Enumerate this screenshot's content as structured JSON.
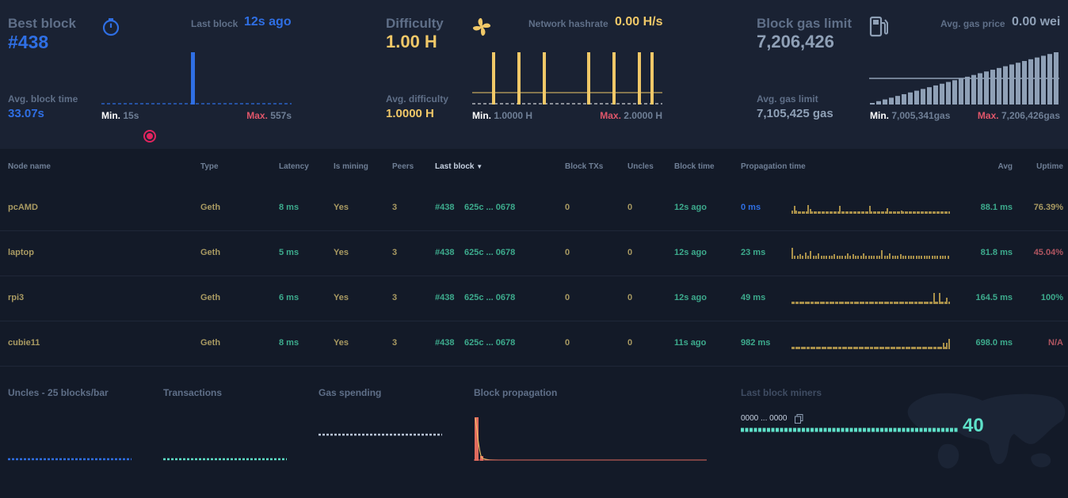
{
  "stats": {
    "best_block": {
      "label": "Best block",
      "value": "#438"
    },
    "avg_block_time": {
      "label": "Avg. block time",
      "value": "33.07s"
    },
    "last_block": {
      "label": "Last block",
      "value": "12s ago"
    },
    "block_time_chart": {
      "min_label": "Min.",
      "min_value": "15s",
      "max_label": "Max.",
      "max_value": "557s"
    },
    "difficulty": {
      "label": "Difficulty",
      "value": "1.00 H"
    },
    "avg_difficulty": {
      "label": "Avg. difficulty",
      "value": "1.0000 H"
    },
    "network_hashrate": {
      "label": "Network hashrate",
      "value": "0.00 H/s"
    },
    "difficulty_chart": {
      "min_label": "Min.",
      "min_value": "1.0000 H",
      "max_label": "Max.",
      "max_value": "2.0000 H"
    },
    "block_gas_limit": {
      "label": "Block gas limit",
      "value": "7,206,426"
    },
    "avg_gas_limit": {
      "label": "Avg. gas limit",
      "value": "7,105,425 gas"
    },
    "avg_gas_price": {
      "label": "Avg. gas price",
      "value": "0.00 wei"
    },
    "gas_chart": {
      "min_label": "Min.",
      "min_value": "7,005,341gas",
      "max_label": "Max.",
      "max_value": "7,206,426gas"
    }
  },
  "table": {
    "headers": [
      "Node name",
      "Type",
      "Latency",
      "Is mining",
      "Peers",
      "Last block",
      "Block TXs",
      "Uncles",
      "Block time",
      "Propagation time",
      "Avg",
      "Uptime"
    ],
    "sort_indicator": "▼",
    "rows": [
      {
        "name": "pcAMD",
        "type": "Geth",
        "latency": "8 ms",
        "mining": "Yes",
        "peers": "3",
        "block": "#438",
        "hash": "625c ... 0678",
        "txs": "0",
        "uncles": "0",
        "block_time": "12s ago",
        "prop": "0 ms",
        "avg": "88.1 ms",
        "uptime": "76.39%",
        "uptime_color": "#a99a62",
        "prop_color": "#2f6fe4"
      },
      {
        "name": "laptop",
        "type": "Geth",
        "latency": "5 ms",
        "mining": "Yes",
        "peers": "3",
        "block": "#438",
        "hash": "625c ... 0678",
        "txs": "0",
        "uncles": "0",
        "block_time": "12s ago",
        "prop": "23 ms",
        "avg": "81.8 ms",
        "uptime": "45.04%",
        "uptime_color": "#b05560",
        "prop_color": "#3dab8d"
      },
      {
        "name": "rpi3",
        "type": "Geth",
        "latency": "6 ms",
        "mining": "Yes",
        "peers": "3",
        "block": "#438",
        "hash": "625c ... 0678",
        "txs": "0",
        "uncles": "0",
        "block_time": "12s ago",
        "prop": "49 ms",
        "avg": "164.5 ms",
        "uptime": "100%",
        "uptime_color": "#3dab8d",
        "prop_color": "#3dab8d"
      },
      {
        "name": "cubie11",
        "type": "Geth",
        "latency": "8 ms",
        "mining": "Yes",
        "peers": "3",
        "block": "#438",
        "hash": "625c ... 0678",
        "txs": "0",
        "uncles": "0",
        "block_time": "11s ago",
        "prop": "982 ms",
        "avg": "698.0 ms",
        "uptime": "N/A",
        "uptime_color": "#b05560",
        "prop_color": "#3dab8d"
      }
    ],
    "prop_histograms": [
      [
        0.3,
        0.7,
        0.3,
        0.2,
        0.2,
        0.2,
        0.2,
        0.2,
        0.8,
        0.4,
        0.2,
        0.2,
        0.2,
        0.2,
        0.2,
        0.2,
        0.2,
        0.2,
        0.2,
        0.2,
        0.2,
        0.2,
        0.2,
        0.2,
        0.7,
        0.2,
        0.2,
        0.2,
        0.2,
        0.2,
        0.2,
        0.2,
        0.2,
        0.2,
        0.2,
        0.2,
        0.2,
        0.2,
        0.2,
        0.7,
        0.2,
        0.2,
        0.2,
        0.2,
        0.2,
        0.2,
        0.2,
        0.2,
        0.5,
        0.2,
        0.2,
        0.2,
        0.2,
        0.2,
        0.2,
        0.3,
        0.2,
        0.2,
        0.2,
        0.2,
        0.2,
        0.2,
        0.2,
        0.2,
        0.2,
        0.2,
        0.2,
        0.2,
        0.2,
        0.2,
        0.2,
        0.2,
        0.2,
        0.2,
        0.2,
        0.2,
        0.2,
        0.2,
        0.2,
        0.2
      ],
      [
        1,
        0.3,
        0.3,
        0.4,
        0.3,
        0.6,
        0.3,
        0.7,
        0.3,
        0.3,
        0.5,
        0.3,
        0.3,
        0.3,
        0.3,
        0.3,
        0.4,
        0.3,
        0.3,
        0.3,
        0.3,
        0.5,
        0.3,
        0.4,
        0.3,
        0.3,
        0.3,
        0.5,
        0.3,
        0.3,
        0.3,
        0.3,
        0.3,
        0.3,
        0.8,
        0.3,
        0.3,
        0.5,
        0.3,
        0.3,
        0.3,
        0.4,
        0.3,
        0.3,
        0.3,
        0.3,
        0.3,
        0.3,
        0.3,
        0.3,
        0.3,
        0.3,
        0.3,
        0.3,
        0.3,
        0.3,
        0.3,
        0.3,
        0.3,
        0.3
      ],
      [
        0.2,
        0.2,
        0.2,
        0.2,
        0.2,
        0.2,
        0.2,
        0.2,
        0.2,
        0.2,
        0.2,
        0.2,
        0.2,
        0.2,
        0.2,
        0.2,
        0.2,
        0.2,
        0.2,
        0.2,
        0.2,
        0.2,
        0.2,
        0.2,
        0.2,
        0.2,
        0.2,
        0.2,
        0.2,
        0.2,
        0.2,
        0.2,
        0.2,
        0.2,
        0.2,
        0.2,
        0.2,
        0.2,
        0.2,
        0.2,
        0.2,
        0.2,
        0.2,
        0.2,
        0.2,
        0.2,
        0.2,
        0.2,
        0.2,
        0.2,
        0.2,
        0.2,
        0.2,
        0.2,
        0.2,
        0.2,
        0.2,
        0.2,
        0.2,
        0.2,
        0.2,
        0.2,
        0.2,
        0.2,
        0.2,
        0.2,
        0.2,
        0.2,
        0.2,
        0.2,
        0.2,
        0.2,
        0.2,
        0.2,
        0.2,
        1,
        0.2,
        0.2,
        1,
        0.2,
        0.2,
        0.2,
        0.6,
        0.2
      ],
      [
        0.2,
        0.2,
        0.2,
        0.2,
        0.2,
        0.2,
        0.2,
        0.2,
        0.2,
        0.2,
        0.2,
        0.2,
        0.2,
        0.2,
        0.2,
        0.2,
        0.2,
        0.2,
        0.2,
        0.2,
        0.2,
        0.2,
        0.2,
        0.2,
        0.2,
        0.2,
        0.2,
        0.2,
        0.2,
        0.2,
        0.2,
        0.2,
        0.2,
        0.2,
        0.2,
        0.2,
        0.2,
        0.2,
        0.2,
        0.2,
        0.2,
        0.2,
        0.2,
        0.2,
        0.2,
        0.2,
        0.2,
        0.2,
        0.2,
        0.2,
        0.2,
        0.2,
        0.2,
        0.2,
        0.2,
        0.2,
        0.2,
        0.2,
        0.2,
        0.2,
        0.2,
        0.2,
        0.2,
        0.2,
        0.2,
        0.2,
        0.2,
        0.2,
        0.2,
        0.2,
        0.2,
        0.2,
        0.2,
        0.2,
        0.2,
        0.2,
        0.2,
        0.2,
        0.2,
        0.2,
        0.2,
        0.6,
        0.2,
        0.6,
        0.9
      ]
    ]
  },
  "bottom": {
    "uncles_title": "Uncles - 25 blocks/bar",
    "transactions_title": "Transactions",
    "gas_spending_title": "Gas spending",
    "block_propagation_title": "Block propagation",
    "last_block_miners_title": "Last block miners",
    "miner_address": "0000 ... 0000",
    "miner_count": "40"
  },
  "colors": {
    "blue": "#2f6fe4",
    "yellow": "#f0c868",
    "grey": "#8fa0b6",
    "red": "#e0566a",
    "teal": "#3dab8d",
    "olive": "#a99a62"
  },
  "icons": [
    "stopwatch-icon",
    "fan-icon",
    "gas-pump-icon",
    "copy-icon",
    "sort-desc-icon",
    "record-icon"
  ]
}
